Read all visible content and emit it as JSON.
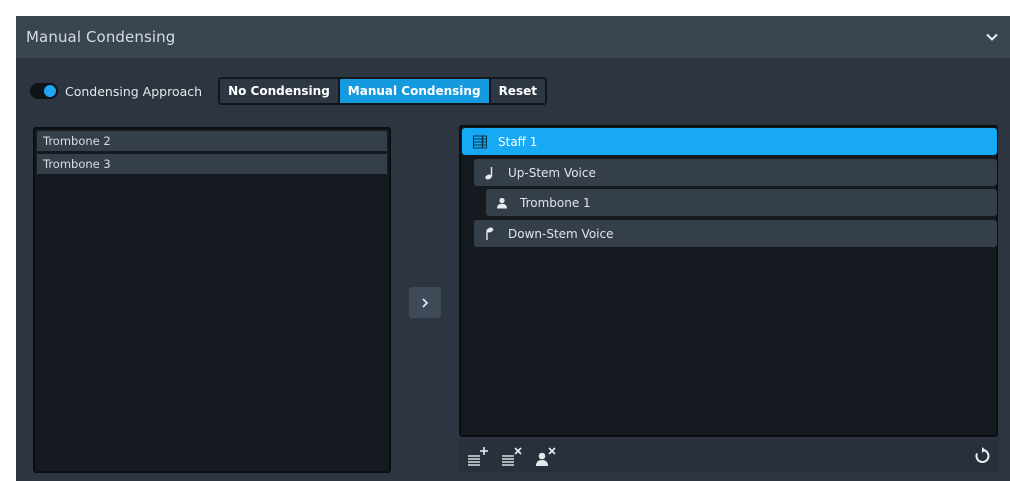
{
  "header": {
    "title": "Manual Condensing",
    "collapse_icon": "chevron-down-icon"
  },
  "approach": {
    "toggle_on": true,
    "label": "Condensing Approach",
    "options": [
      "No Condensing",
      "Manual Condensing",
      "Reset"
    ],
    "selected": "Manual Condensing"
  },
  "left_list": {
    "items": [
      "Trombone 2",
      "Trombone 3"
    ]
  },
  "move_button": {
    "label": ">"
  },
  "tree": {
    "nodes": [
      {
        "label": "Staff 1",
        "icon": "staff-icon",
        "level": 0,
        "selected": true
      },
      {
        "label": "Up-Stem Voice",
        "icon": "up-stem-note-icon",
        "level": 1,
        "selected": false
      },
      {
        "label": "Trombone 1",
        "icon": "player-icon",
        "level": 2,
        "selected": false
      },
      {
        "label": "Down-Stem Voice",
        "icon": "down-stem-note-icon",
        "level": 1,
        "selected": false
      }
    ]
  },
  "toolbar": {
    "buttons": [
      "add-staff-icon",
      "remove-staff-icon",
      "remove-player-icon"
    ],
    "reset_icon": "reset-icon"
  },
  "colors": {
    "accent": "#17a9f4",
    "panel": "#2c3540",
    "header": "#3a4552",
    "list_bg": "#141a20"
  }
}
